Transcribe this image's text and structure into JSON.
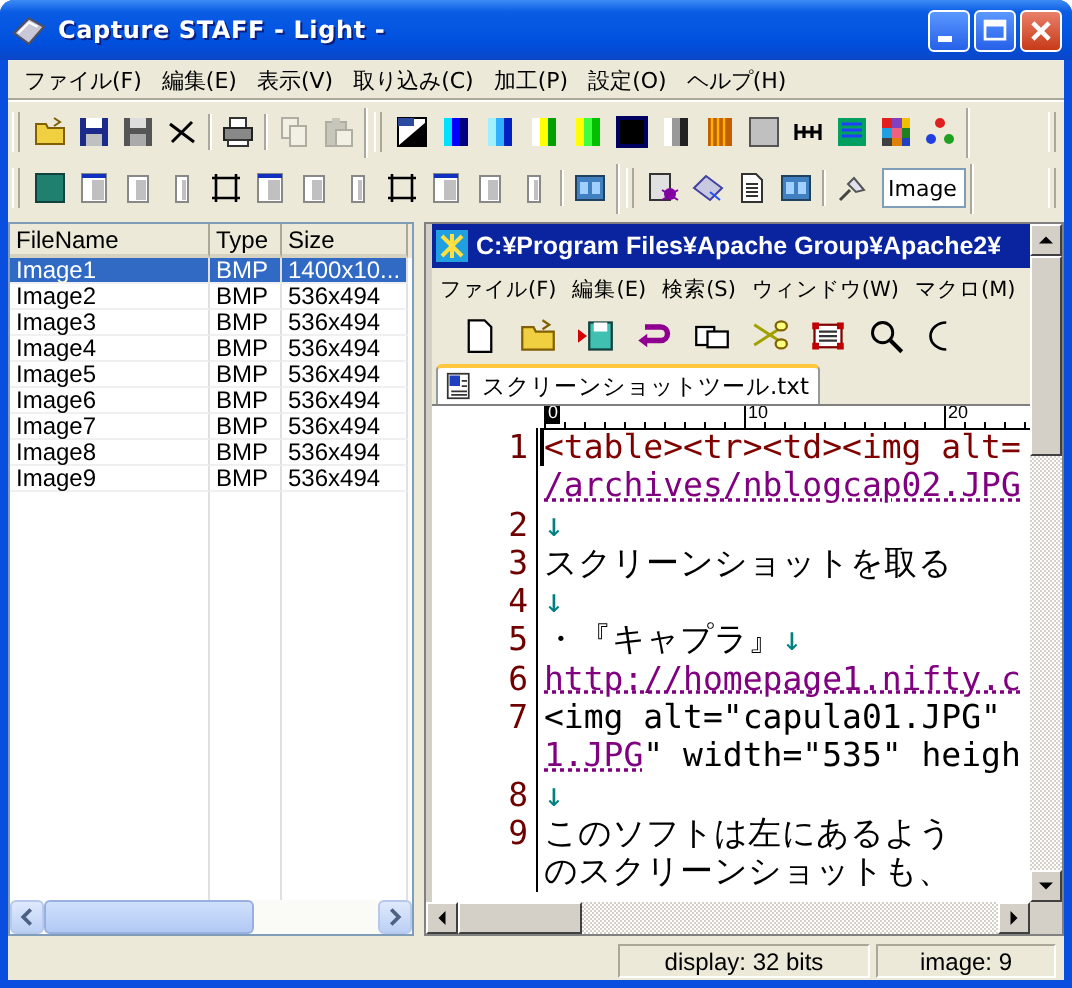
{
  "window": {
    "title": "Capture STAFF - Light -"
  },
  "menu": [
    "ファイル(F)",
    "編集(E)",
    "表示(V)",
    "取り込み(C)",
    "加工(P)",
    "設定(O)",
    "ヘルプ(H)"
  ],
  "toolbar_rows": [
    [
      [
        {
          "kind": "open",
          "disabled": false
        },
        {
          "kind": "save",
          "disabled": false
        },
        {
          "kind": "savegrey",
          "disabled": false
        },
        {
          "kind": "cross",
          "disabled": false
        },
        {
          "kind": "separator"
        },
        {
          "kind": "print",
          "disabled": false
        },
        {
          "kind": "separator"
        },
        {
          "kind": "copy",
          "disabled": true
        },
        {
          "kind": "paste",
          "disabled": true
        }
      ],
      [
        {
          "kind": "mono",
          "disabled": false
        },
        {
          "kind": "bluecyan",
          "disabled": false
        },
        {
          "kind": "dither",
          "disabled": false
        },
        {
          "kind": "yellowgreen",
          "disabled": false
        },
        {
          "kind": "greenyellow",
          "disabled": false
        },
        {
          "kind": "black",
          "disabled": false
        },
        {
          "kind": "greyramp",
          "disabled": false
        },
        {
          "kind": "stripes",
          "disabled": false
        },
        {
          "kind": "grey",
          "disabled": false
        },
        {
          "kind": "hbar",
          "disabled": false
        },
        {
          "kind": "bars",
          "disabled": false
        },
        {
          "kind": "mosaic",
          "disabled": false
        },
        {
          "kind": "dots",
          "disabled": false
        }
      ]
    ],
    [
      [
        {
          "kind": "panel",
          "disabled": false
        },
        {
          "kind": "winlarge",
          "disabled": false
        },
        {
          "kind": "winmid",
          "disabled": false
        },
        {
          "kind": "winslim",
          "disabled": false
        },
        {
          "kind": "frame",
          "disabled": false
        },
        {
          "kind": "winlarge",
          "disabled": false
        },
        {
          "kind": "winmid",
          "disabled": false
        },
        {
          "kind": "winslim",
          "disabled": false
        },
        {
          "kind": "frame",
          "disabled": false
        },
        {
          "kind": "winlarge",
          "disabled": false
        },
        {
          "kind": "winmid",
          "disabled": false
        },
        {
          "kind": "winslim",
          "disabled": false
        },
        {
          "kind": "separator"
        },
        {
          "kind": "tile",
          "disabled": false
        }
      ],
      [
        {
          "kind": "bugpage",
          "disabled": false
        },
        {
          "kind": "diamond",
          "disabled": false
        },
        {
          "kind": "page",
          "disabled": false
        },
        {
          "kind": "tile",
          "disabled": false
        },
        {
          "kind": "separator"
        },
        {
          "kind": "pin",
          "disabled": false
        },
        {
          "kind": "field",
          "value": "Image"
        }
      ]
    ]
  ],
  "file_list": {
    "columns": [
      "FileName",
      "Type",
      "Size"
    ],
    "rows": [
      {
        "cells": [
          "Image1",
          "BMP",
          "1400x10..."
        ],
        "selected": true
      },
      {
        "cells": [
          "Image2",
          "BMP",
          "536x494"
        ],
        "selected": false
      },
      {
        "cells": [
          "Image3",
          "BMP",
          "536x494"
        ],
        "selected": false
      },
      {
        "cells": [
          "Image4",
          "BMP",
          "536x494"
        ],
        "selected": false
      },
      {
        "cells": [
          "Image5",
          "BMP",
          "536x494"
        ],
        "selected": false
      },
      {
        "cells": [
          "Image6",
          "BMP",
          "536x494"
        ],
        "selected": false
      },
      {
        "cells": [
          "Image7",
          "BMP",
          "536x494"
        ],
        "selected": false
      },
      {
        "cells": [
          "Image8",
          "BMP",
          "536x494"
        ],
        "selected": false
      },
      {
        "cells": [
          "Image9",
          "BMP",
          "536x494"
        ],
        "selected": false
      }
    ]
  },
  "editor": {
    "title": "C:¥Program Files¥Apache Group¥Apache2¥",
    "menu": [
      "ファイル(F)",
      "編集(E)",
      "検索(S)",
      "ウィンドウ(W)",
      "マクロ(M)"
    ],
    "toolbar": [
      {
        "kind": "new"
      },
      {
        "kind": "open"
      },
      {
        "kind": "saveas"
      },
      {
        "kind": "undo"
      },
      {
        "kind": "copy"
      },
      {
        "kind": "cut"
      },
      {
        "kind": "select"
      },
      {
        "kind": "find"
      },
      {
        "kind": "circle"
      }
    ],
    "tabs": [
      {
        "label": "スクリーンショットツール.txt",
        "selected": true
      }
    ],
    "ruler": [
      "0",
      "10",
      "20"
    ],
    "lines": [
      {
        "number": "1",
        "segments": [
          {
            "kind": "tag",
            "text": "<table><tr><td><img alt="
          }
        ]
      },
      {
        "segments": [
          {
            "kind": "url",
            "text": "/archives/nblogcap02.JPG"
          }
        ]
      },
      {
        "number": "2",
        "segments": [
          {
            "kind": "mark",
            "text": "↓"
          }
        ]
      },
      {
        "number": "3",
        "segments": [
          {
            "kind": "plain",
            "text": "スクリーンショットを取る"
          }
        ]
      },
      {
        "number": "4",
        "segments": [
          {
            "kind": "mark",
            "text": "↓"
          }
        ]
      },
      {
        "number": "5",
        "segments": [
          {
            "kind": "plain",
            "text": "・『キャプラ』"
          },
          {
            "kind": "mark",
            "text": "↓"
          }
        ]
      },
      {
        "number": "6",
        "segments": [
          {
            "kind": "url",
            "text": "http://homepage1.nifty.c"
          }
        ]
      },
      {
        "number": "7",
        "segments": [
          {
            "kind": "plain",
            "text": "<img alt=\"capula01.JPG\""
          }
        ]
      },
      {
        "segments": [
          {
            "kind": "url",
            "text": "1.JPG"
          },
          {
            "kind": "plain",
            "text": "\" width=\"535\" heigh"
          }
        ]
      },
      {
        "number": "8",
        "segments": [
          {
            "kind": "mark",
            "text": "↓"
          }
        ]
      },
      {
        "number": "9",
        "segments": [
          {
            "kind": "plain",
            "text": "このソフトは左にあるよう"
          }
        ]
      },
      {
        "segments": [
          {
            "kind": "plain",
            "text": "のスクリーンショットも、"
          }
        ]
      }
    ]
  },
  "status_bar": [
    "display: 32 bits",
    "image: 9"
  ]
}
